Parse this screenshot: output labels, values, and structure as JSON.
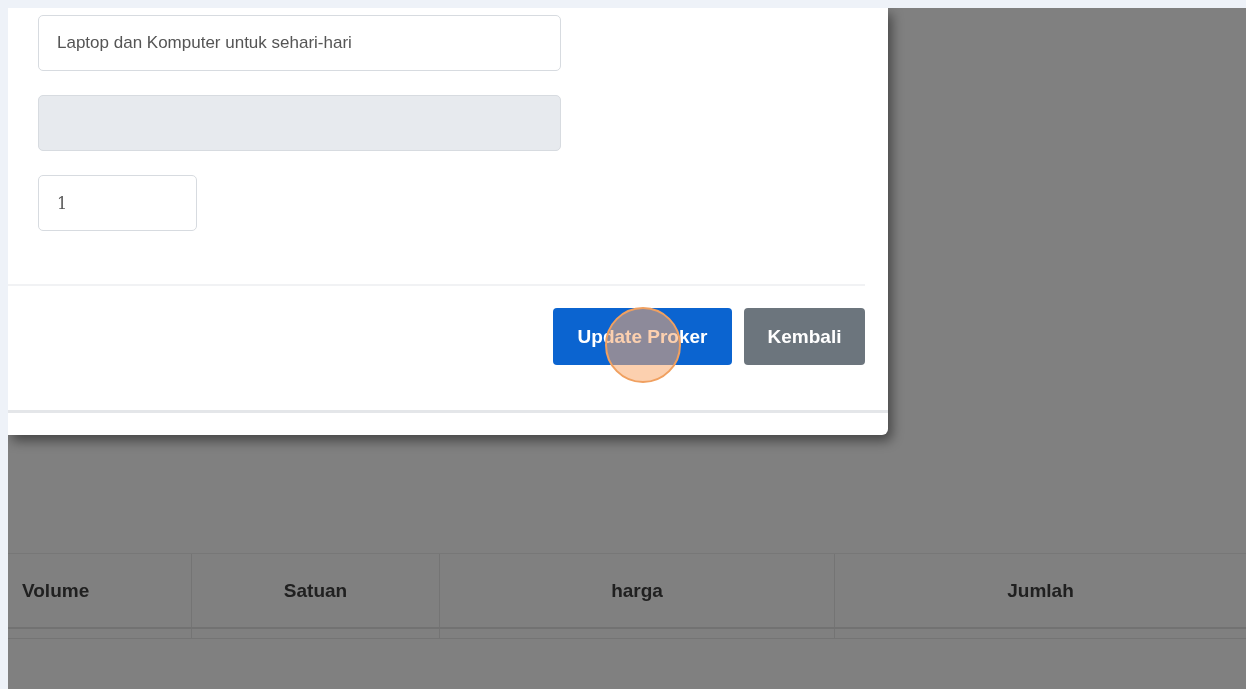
{
  "form": {
    "fields": [
      {
        "kind": "text",
        "value": "Laptop dan Komputer untuk sehari-hari",
        "disabled": false
      },
      {
        "kind": "text",
        "disabled": true
      },
      {
        "kind": "number",
        "value": "1",
        "disabled": false
      }
    ],
    "buttons": [
      {
        "label": "Update Proker",
        "kind": "primary"
      },
      {
        "label": "Kembali",
        "kind": "secondary"
      }
    ]
  },
  "table": {
    "columns": [
      "Volume",
      "Satuan",
      "harga",
      "Jumlah"
    ]
  }
}
